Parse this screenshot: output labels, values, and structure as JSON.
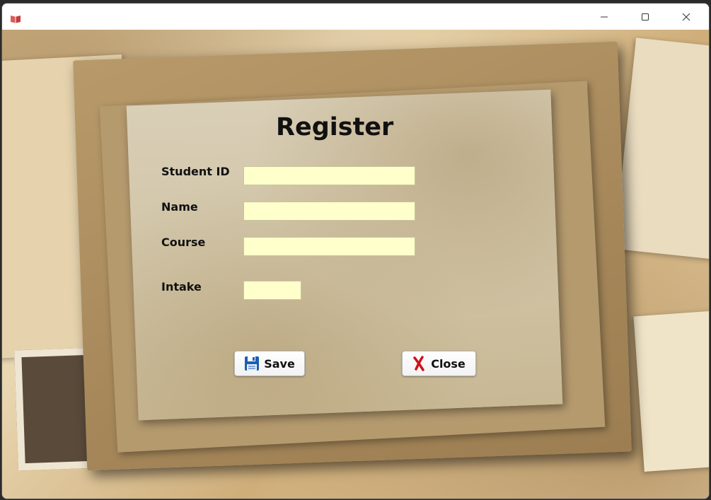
{
  "window": {
    "title": ""
  },
  "form": {
    "title": "Register",
    "fields": [
      {
        "label": "Student ID",
        "value": ""
      },
      {
        "label": "Name",
        "value": ""
      },
      {
        "label": "Course",
        "value": ""
      },
      {
        "label": "Intake",
        "value": ""
      }
    ],
    "save_label": "Save",
    "close_label": "Close"
  },
  "colors": {
    "field_bg": "#ffffcc",
    "close_icon": "#d0101a",
    "save_icon": "#1a5fb4"
  },
  "icons": {
    "app": "book-icon",
    "save": "floppy-disk-icon",
    "close": "red-x-icon"
  }
}
